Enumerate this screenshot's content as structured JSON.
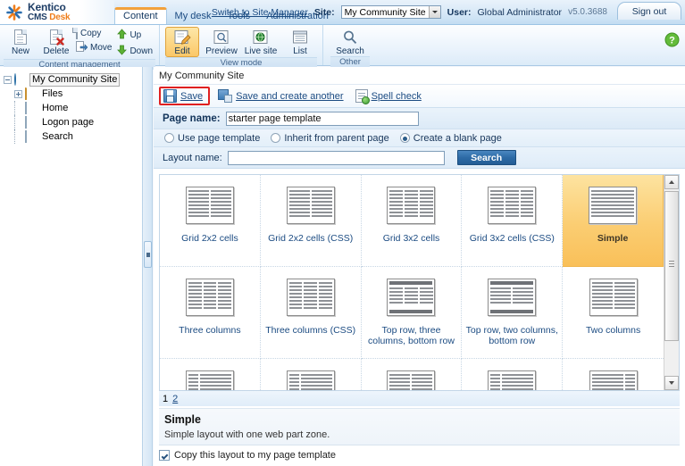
{
  "header": {
    "logo_line1": "Kentico",
    "logo_line2_cms": "CMS ",
    "logo_line2_desk": "Desk",
    "logo_icon": "kentico-star-icon",
    "tabs": [
      {
        "label": "Content",
        "active": true
      },
      {
        "label": "My desk",
        "active": false
      },
      {
        "label": "Tools",
        "active": false
      },
      {
        "label": "Administration",
        "active": false
      }
    ],
    "switch_link": "Switch to Site Manager",
    "site_label": "Site:",
    "site_value": "My Community Site",
    "user_label": "User:",
    "user_value": "Global Administrator",
    "version": "v5.0.3688",
    "signout_label": "Sign out"
  },
  "toolbar": {
    "groups": [
      {
        "caption": "Content management",
        "big": [
          {
            "label": "New",
            "icon": "new-document-icon"
          },
          {
            "label": "Delete",
            "icon": "delete-document-icon"
          }
        ],
        "small": [
          {
            "label": "Copy",
            "icon": "copy-icon"
          },
          {
            "label": "Move",
            "icon": "move-icon"
          },
          {
            "label": "Up",
            "icon": "arrow-up-icon"
          },
          {
            "label": "Down",
            "icon": "arrow-down-icon"
          }
        ]
      },
      {
        "caption": "View mode",
        "big": [
          {
            "label": "Edit",
            "icon": "edit-pencil-icon",
            "selected": true
          },
          {
            "label": "Preview",
            "icon": "preview-magnifier-icon"
          },
          {
            "label": "Live site",
            "icon": "live-site-globe-icon"
          },
          {
            "label": "List",
            "icon": "list-icon"
          }
        ],
        "small": []
      },
      {
        "caption": "Other",
        "big": [
          {
            "label": "Search",
            "icon": "search-magnifier-icon"
          }
        ],
        "small": []
      }
    ],
    "help_icon": "help-question-icon"
  },
  "tree": {
    "nodes": [
      {
        "label": "My Community Site",
        "icon": "globe-icon",
        "level": 0,
        "expander": "minus",
        "selected": true
      },
      {
        "label": "Files",
        "icon": "folder-icon",
        "level": 1,
        "expander": "plus",
        "selected": false
      },
      {
        "label": "Home",
        "icon": "page-icon",
        "level": 1,
        "expander": "none",
        "selected": false
      },
      {
        "label": "Logon page",
        "icon": "page-icon",
        "level": 1,
        "expander": "none",
        "selected": false
      },
      {
        "label": "Search",
        "icon": "page-icon",
        "level": 1,
        "expander": "none",
        "selected": false
      }
    ]
  },
  "content": {
    "breadcrumb": "My Community Site",
    "actions": [
      {
        "label": "Save",
        "icon": "save-icon",
        "highlighted": true
      },
      {
        "label": "Save and create another",
        "icon": "save-create-another-icon",
        "highlighted": false
      },
      {
        "label": "Spell check",
        "icon": "spell-check-icon",
        "highlighted": false
      }
    ],
    "page_name_label": "Page name:",
    "page_name_value": "starter page template",
    "page_name_placeholder": "",
    "template_options": [
      {
        "label": "Use page template",
        "selected": false
      },
      {
        "label": "Inherit from parent page",
        "selected": false
      },
      {
        "label": "Create a blank page",
        "selected": true
      }
    ],
    "layout_name_label": "Layout name:",
    "layout_name_value": "",
    "layout_name_placeholder": "",
    "search_button": "Search"
  },
  "layouts": {
    "items": [
      {
        "label": "Grid 2x2 cells",
        "thumb": "grid-2x2",
        "selected": false
      },
      {
        "label": "Grid 2x2 cells (CSS)",
        "thumb": "grid-2x2",
        "selected": false
      },
      {
        "label": "Grid 3x2 cells",
        "thumb": "grid-3x2",
        "selected": false
      },
      {
        "label": "Grid 3x2 cells (CSS)",
        "thumb": "grid-3x2",
        "selected": false
      },
      {
        "label": "Simple",
        "thumb": "simple",
        "selected": true
      },
      {
        "label": "Three columns",
        "thumb": "three-col",
        "selected": false
      },
      {
        "label": "Three columns (CSS)",
        "thumb": "three-col",
        "selected": false
      },
      {
        "label": "Top row, three columns, bottom row",
        "thumb": "top-three-bottom",
        "selected": false
      },
      {
        "label": "Top row, two columns, bottom row",
        "thumb": "top-two-bottom",
        "selected": false
      },
      {
        "label": "Two columns",
        "thumb": "two-col",
        "selected": false
      },
      {
        "label": "",
        "thumb": "partial-a",
        "selected": false
      },
      {
        "label": "",
        "thumb": "partial-b",
        "selected": false
      },
      {
        "label": "",
        "thumb": "partial-c",
        "selected": false
      },
      {
        "label": "",
        "thumb": "partial-d",
        "selected": false
      },
      {
        "label": "",
        "thumb": "partial-e",
        "selected": false
      }
    ],
    "pages": [
      {
        "label": "1",
        "current": true
      },
      {
        "label": "2",
        "current": false
      }
    ]
  },
  "details": {
    "title": "Simple",
    "description": "Simple layout with one web part zone.",
    "copy_checkbox_label": "Copy this layout to my page template",
    "copy_checkbox_checked": true
  }
}
